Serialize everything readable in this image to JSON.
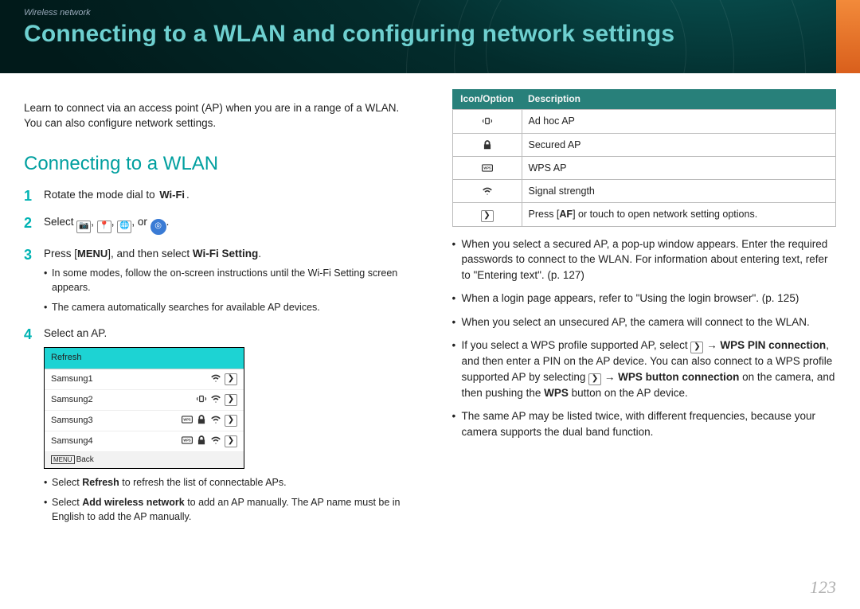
{
  "header": {
    "breadcrumb": "Wireless network",
    "title": "Connecting to a WLAN and configuring network settings"
  },
  "intro": "Learn to connect via an access point (AP) when you are in a range of a WLAN. You can also configure network settings.",
  "section_title": "Connecting to a WLAN",
  "steps": {
    "s1_pre": "Rotate the mode dial to ",
    "s1_wifi": "Wi-Fi",
    "s1_post": ".",
    "s2_pre": "Select ",
    "s2_or": ", or ",
    "s2_post": ".",
    "s3_pre": "Press [",
    "s3_menu": "MENU",
    "s3_mid": "], and then select ",
    "s3_bold": "Wi-Fi Setting",
    "s3_post": ".",
    "s3_sub1": "In some modes, follow the on-screen instructions until the Wi-Fi Setting screen appears.",
    "s3_sub2": "The camera automatically searches for available AP devices.",
    "s4": "Select an AP.",
    "s4_sub1_pre": "Select ",
    "s4_sub1_bold": "Refresh",
    "s4_sub1_post": " to refresh the list of connectable APs.",
    "s4_sub2_pre": "Select ",
    "s4_sub2_bold": "Add wireless network",
    "s4_sub2_post": " to add an AP manually. The AP name must be in English to add the AP manually."
  },
  "ap_list": {
    "refresh": "Refresh",
    "items": [
      "Samsung1",
      "Samsung2",
      "Samsung3",
      "Samsung4"
    ],
    "back_key": "MENU",
    "back": "Back"
  },
  "table": {
    "h1": "Icon/Option",
    "h2": "Description",
    "rows": [
      {
        "desc": "Ad hoc AP"
      },
      {
        "desc": "Secured AP"
      },
      {
        "desc": "WPS AP"
      },
      {
        "desc": "Signal strength"
      },
      {
        "desc_pre": "Press [",
        "desc_key": "AF",
        "desc_post": "] or touch to open network setting options."
      }
    ]
  },
  "right_bullets": {
    "b1": "When you select a secured AP, a pop-up window appears. Enter the required passwords to connect to the WLAN. For information about entering text, refer to \"Entering text\". (p. 127)",
    "b2": "When a login page appears, refer to \"Using the login browser\". (p. 125)",
    "b3": "When you select an unsecured AP, the camera will connect to the WLAN.",
    "b4_pre": "If you select a WPS profile supported AP, select ",
    "b4_bold1": "WPS PIN connection",
    "b4_mid1": ", and then enter a PIN on the AP device. You can also connect to a WPS profile supported AP by selecting ",
    "b4_bold2": "WPS button connection",
    "b4_mid2": " on the camera, and then pushing the ",
    "b4_bold3": "WPS",
    "b4_post": " button on the AP device.",
    "b5": "The same AP may be listed twice, with different frequencies, because your camera supports the dual band function."
  },
  "arrow": " → ",
  "page_number": "123"
}
